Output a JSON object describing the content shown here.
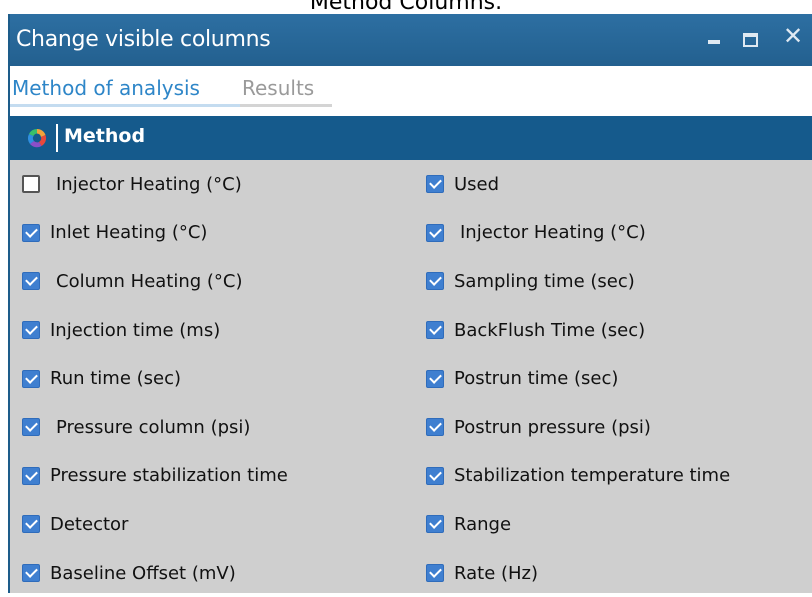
{
  "caption": "Method Columns.",
  "window": {
    "title": "Change visible columns",
    "minimize_label": "minimize",
    "maximize_label": "maximize",
    "close_glyph": "✕"
  },
  "tabs": [
    {
      "label": "Method of analysis",
      "active": true
    },
    {
      "label": "Results",
      "active": false
    }
  ],
  "section": {
    "title": "Method",
    "icon": "multicolor-logo-icon"
  },
  "columns": {
    "left": [
      {
        "label": "Injector Heating (°C)",
        "checked": false
      },
      {
        "label": "Inlet Heating (°C)",
        "checked": true
      },
      {
        "label": "Column Heating (°C)",
        "checked": true
      },
      {
        "label": "Injection time (ms)",
        "checked": true
      },
      {
        "label": "Run time (sec)",
        "checked": true
      },
      {
        "label": "Pressure column (psi)",
        "checked": true
      },
      {
        "label": "Pressure stabilization time",
        "checked": true
      },
      {
        "label": "Detector",
        "checked": true
      },
      {
        "label": "Baseline Offset (mV)",
        "checked": true
      }
    ],
    "right": [
      {
        "label": "Used",
        "checked": true
      },
      {
        "label": "Injector Heating (°C)",
        "checked": true
      },
      {
        "label": "Sampling time (sec)",
        "checked": true
      },
      {
        "label": "BackFlush Time (sec)",
        "checked": true
      },
      {
        "label": "Postrun time (sec)",
        "checked": true
      },
      {
        "label": "Postrun pressure (psi)",
        "checked": true
      },
      {
        "label": "Stabilization temperature time",
        "checked": true
      },
      {
        "label": "Range",
        "checked": true
      },
      {
        "label": "Rate (Hz)",
        "checked": true
      }
    ]
  },
  "colors": {
    "titlebar": "#2a6899",
    "section_header": "#155a8c",
    "active_tab": "#2e86c8",
    "inactive_tab": "#9a9a9a",
    "checkbox": "#3f7fd0",
    "body_bg": "#cfcfcf"
  }
}
